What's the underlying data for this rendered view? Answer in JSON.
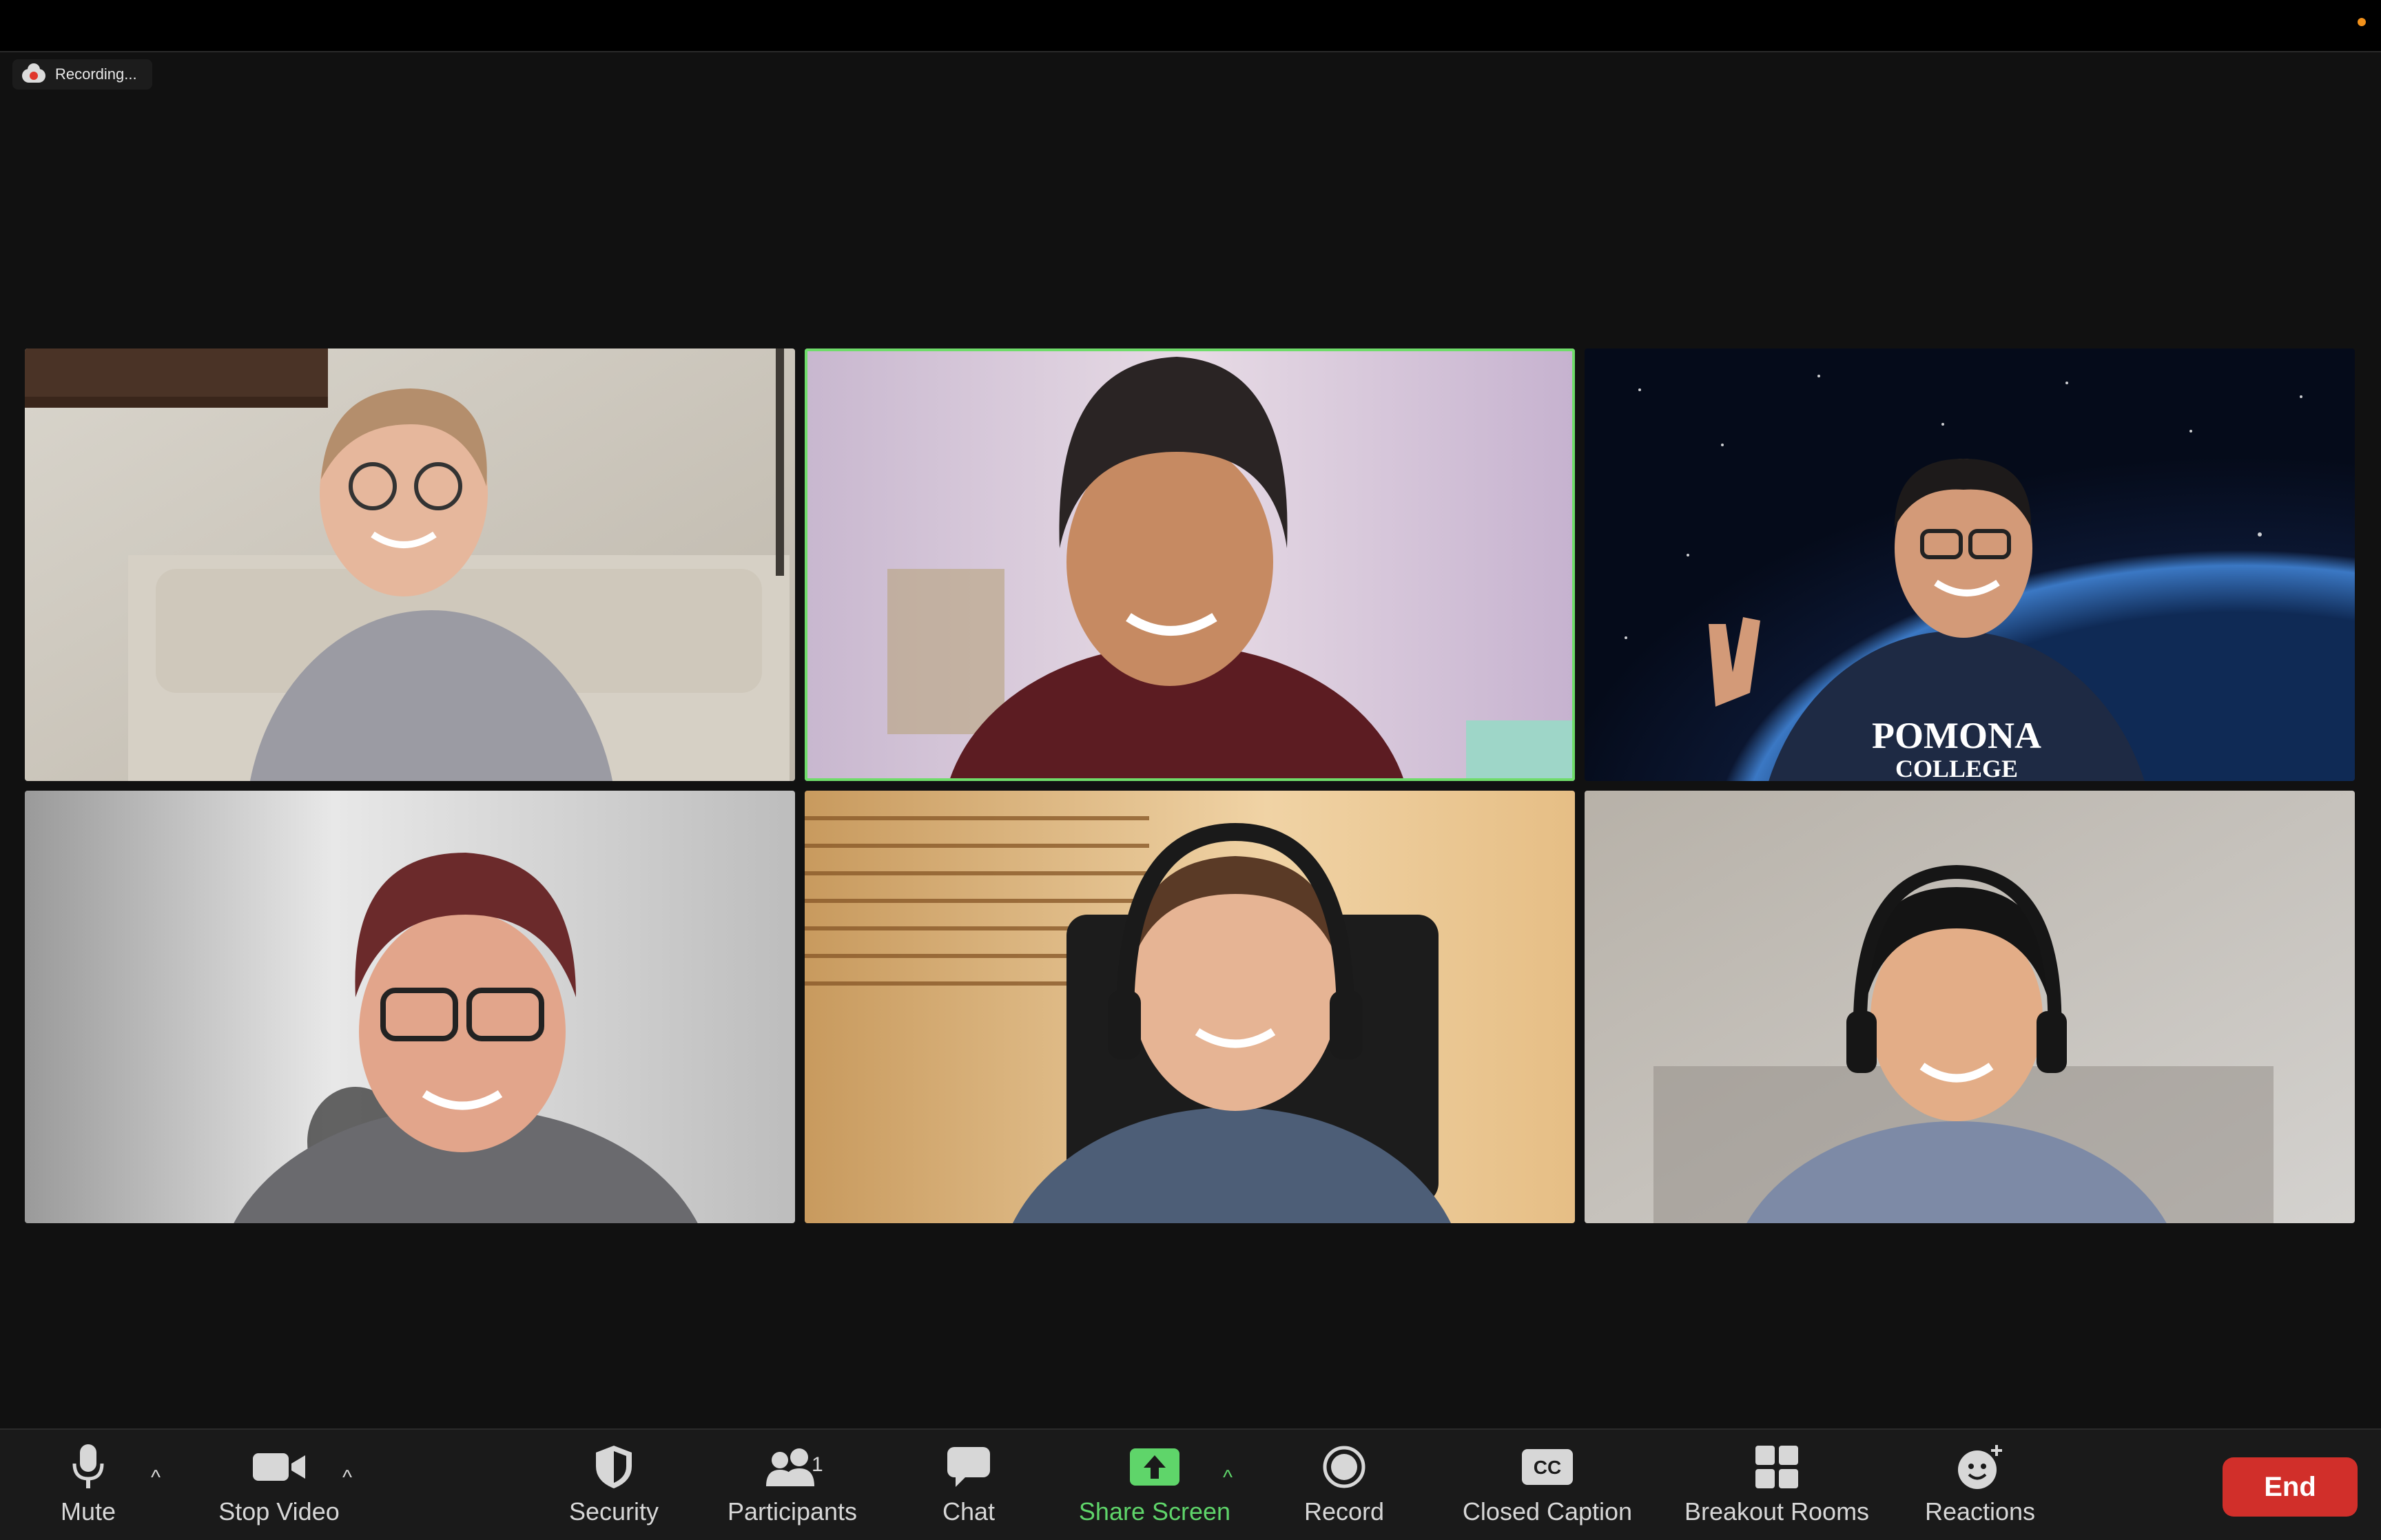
{
  "recording": {
    "label": "Recording..."
  },
  "participants": [
    {
      "position": "top-left",
      "active": false
    },
    {
      "position": "top-center",
      "active": true
    },
    {
      "position": "top-right",
      "active": false,
      "shirt_text": "POMONA COLLEGE"
    },
    {
      "position": "bottom-left",
      "active": false
    },
    {
      "position": "bottom-center",
      "active": false
    },
    {
      "position": "bottom-right",
      "active": false
    }
  ],
  "toolbar": {
    "mute": {
      "label": "Mute",
      "icon": "microphone-icon"
    },
    "video": {
      "label": "Stop Video",
      "icon": "video-camera-icon"
    },
    "security": {
      "label": "Security",
      "icon": "shield-icon"
    },
    "participants": {
      "label": "Participants",
      "icon": "people-icon",
      "count": "1"
    },
    "chat": {
      "label": "Chat",
      "icon": "chat-bubble-icon"
    },
    "share": {
      "label": "Share Screen",
      "icon": "share-screen-icon"
    },
    "record": {
      "label": "Record",
      "icon": "record-icon"
    },
    "cc": {
      "label": "Closed Caption",
      "icon": "closed-caption-icon",
      "glyph": "CC"
    },
    "breakout": {
      "label": "Breakout Rooms",
      "icon": "grid-icon"
    },
    "reactions": {
      "label": "Reactions",
      "icon": "smiley-plus-icon"
    },
    "end": {
      "label": "End"
    }
  },
  "colors": {
    "background": "#111111",
    "toolbar": "#1a1a1a",
    "active_speaker": "#6fdc6a",
    "share_green": "#5fd56a",
    "end_red": "#d12f2a",
    "recording_dot": "#e0352b"
  }
}
